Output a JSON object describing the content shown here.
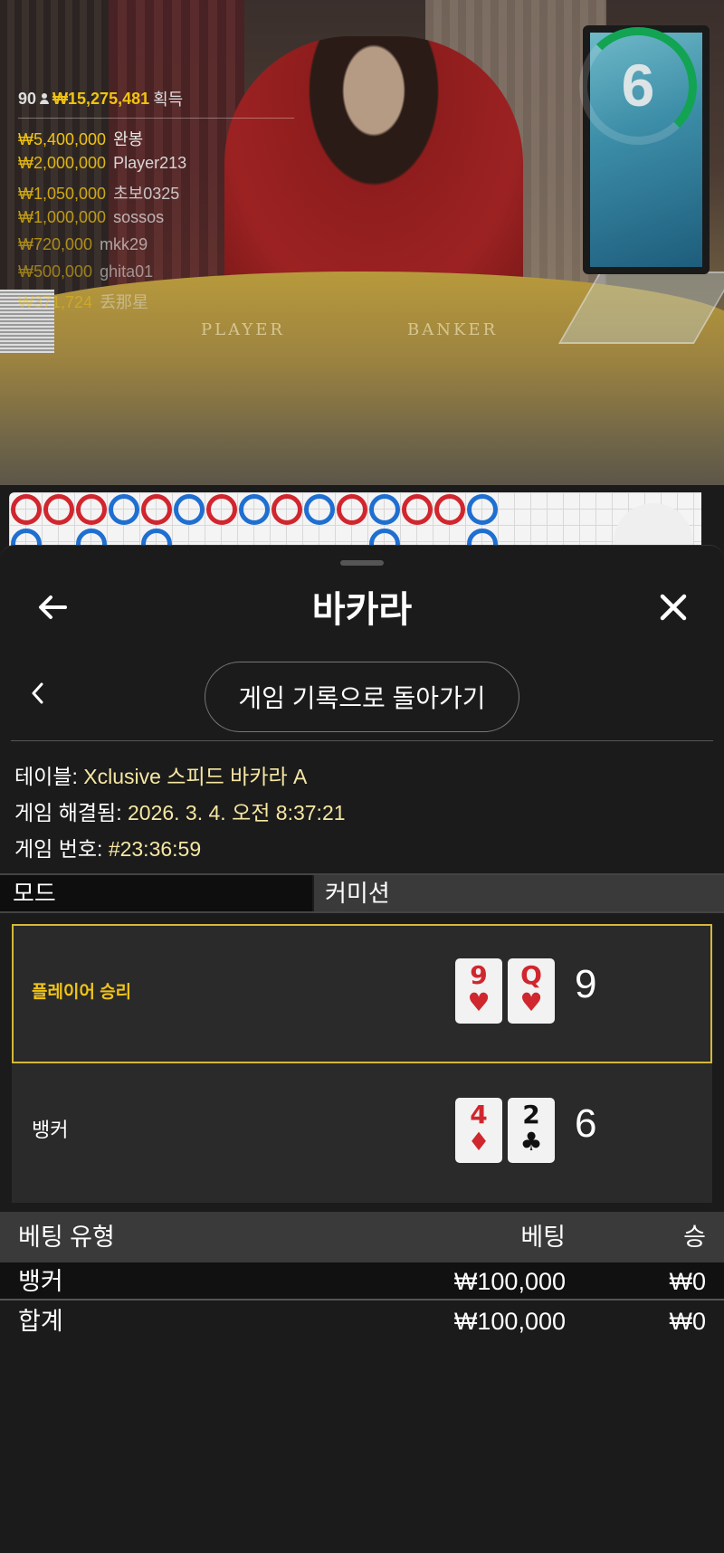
{
  "game_view": {
    "timer": "6",
    "table_labels": {
      "player": "PLAYER",
      "banker": "BANKER"
    },
    "winners": {
      "count": "90",
      "total": "₩15,275,481",
      "total_label": "획득",
      "list": [
        {
          "amount": "₩5,400,000",
          "name": "완봉"
        },
        {
          "amount": "₩2,000,000",
          "name": "Player213"
        },
        {
          "amount": "₩1,050,000",
          "name": "초보0325"
        },
        {
          "amount": "₩1,000,000",
          "name": "sossos"
        },
        {
          "amount": "₩720,000",
          "name": "mkk29"
        },
        {
          "amount": "₩500,000",
          "name": "ghita01"
        },
        {
          "amount": "₩371,724",
          "name": "丢那星"
        }
      ]
    }
  },
  "bead_road": {
    "top_row": [
      "B",
      "B",
      "B",
      "P",
      "B",
      "P",
      "B",
      "P",
      "B",
      "P",
      "B",
      "P",
      "B",
      "B",
      "P"
    ],
    "bottom_row": [
      "P",
      "",
      "P",
      "",
      "P",
      "",
      "",
      "",
      "",
      "",
      "",
      "P",
      "",
      "",
      "P"
    ],
    "colors": {
      "player": "#1f6fd1",
      "banker": "#d1262e"
    }
  },
  "sheet": {
    "title": "바카라",
    "back_to_history": "게임 기록으로 돌아가기",
    "info": {
      "table_label": "테이블:",
      "table_value": "Xclusive 스피드 바카라 A",
      "resolved_label": "게임 해결됨:",
      "resolved_value": "2026. 3. 4. 오전 8:37:21",
      "number_label": "게임 번호:",
      "number_value": "#23:36:59"
    },
    "mode": {
      "label": "모드",
      "value": "커미션"
    },
    "results": {
      "player": {
        "label": "플레이어 승리",
        "cards": [
          {
            "rank": "9",
            "suit": "♥",
            "color": "red"
          },
          {
            "rank": "Q",
            "suit": "♥",
            "color": "red"
          }
        ],
        "score": "9"
      },
      "banker": {
        "label": "뱅커",
        "cards": [
          {
            "rank": "4",
            "suit": "♦",
            "color": "red"
          },
          {
            "rank": "2",
            "suit": "♣",
            "color": "black"
          }
        ],
        "score": "6"
      }
    },
    "bets": {
      "headers": {
        "type": "베팅 유형",
        "bet": "베팅",
        "win": "승"
      },
      "rows": [
        {
          "type": "뱅커",
          "bet": "₩100,000",
          "win": "₩0"
        }
      ],
      "total": {
        "type": "합계",
        "bet": "₩100,000",
        "win": "₩0"
      }
    },
    "accent_color": "#d4b73a"
  }
}
